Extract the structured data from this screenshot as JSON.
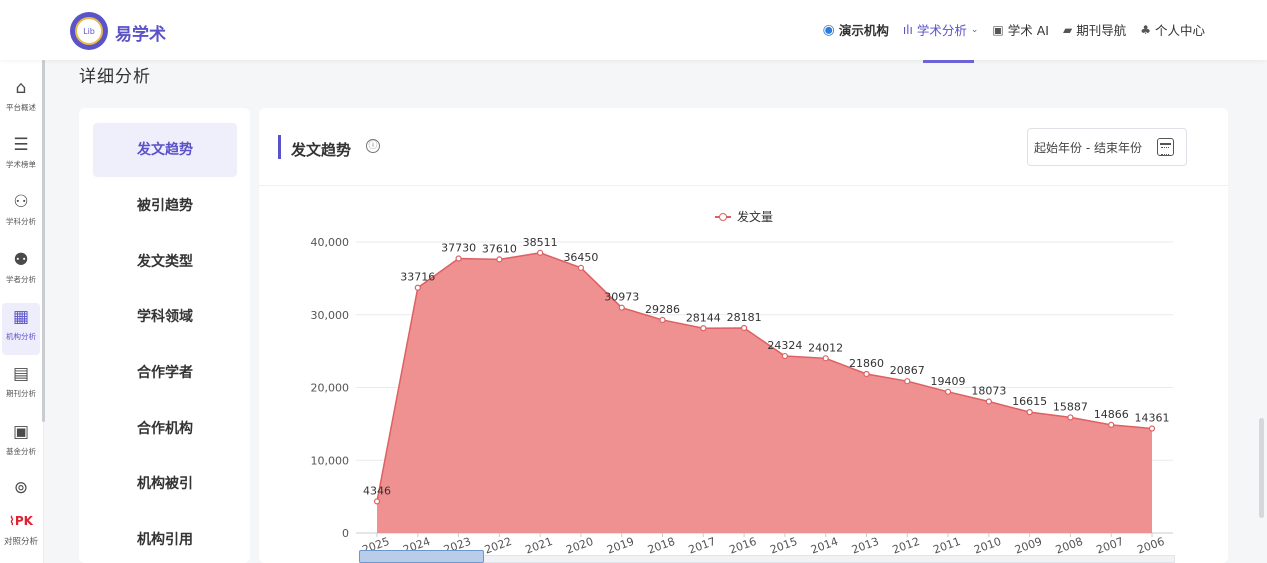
{
  "header": {
    "brand": "易学术",
    "logo_text": "Lib",
    "nav": [
      {
        "label": "演示机构",
        "icon": "institution-globe-icon"
      },
      {
        "label": "学术分析",
        "icon": "bar-chart-icon",
        "active": true,
        "dropdown": true
      },
      {
        "label": "学术 AI",
        "icon": "ai-bot-icon"
      },
      {
        "label": "期刊导航",
        "icon": "book-icon"
      },
      {
        "label": "个人中心",
        "icon": "user-icon"
      }
    ]
  },
  "sidebar": {
    "items": [
      {
        "label": "平台概述",
        "icon": "home-icon"
      },
      {
        "label": "学术榜单",
        "icon": "list-icon"
      },
      {
        "label": "学科分析",
        "icon": "hierarchy-icon"
      },
      {
        "label": "学者分析",
        "icon": "users-icon"
      },
      {
        "label": "机构分析",
        "icon": "building-icon",
        "active": true
      },
      {
        "label": "期刊分析",
        "icon": "journal-icon"
      },
      {
        "label": "基金分析",
        "icon": "money-icon"
      },
      {
        "label": "",
        "icon": "location-pin-icon"
      },
      {
        "label": "对照分析",
        "icon": "pk-chart-icon"
      }
    ]
  },
  "page_title": "详细分析",
  "submenu": {
    "items": [
      "发文趋势",
      "被引趋势",
      "发文类型",
      "学科领域",
      "合作学者",
      "合作机构",
      "机构被引",
      "机构引用"
    ],
    "active_index": 0
  },
  "card": {
    "title": "发文趋势",
    "info_icon": "ⓘ",
    "year_range_placeholder": "起始年份 - 结束年份"
  },
  "colors": {
    "accent": "#5a52c8",
    "series_line": "#dd6063",
    "series_fill": "#ee8b8b"
  },
  "chart_data": {
    "type": "area",
    "title": "",
    "xlabel": "",
    "ylabel": "",
    "x": [
      "2025",
      "2024",
      "2023",
      "2022",
      "2021",
      "2020",
      "2019",
      "2018",
      "2017",
      "2016",
      "2015",
      "2014",
      "2013",
      "2012",
      "2011",
      "2010",
      "2009",
      "2008",
      "2007",
      "2006"
    ],
    "series": [
      {
        "name": "发文量",
        "values": [
          4346,
          33716,
          37730,
          37610,
          38511,
          36450,
          30973,
          29286,
          28144,
          28181,
          24324,
          24012,
          21860,
          20867,
          19409,
          18073,
          16615,
          15887,
          14866,
          14361
        ]
      }
    ],
    "ylim": [
      0,
      40000
    ],
    "yticks": [
      "0",
      "10,000",
      "20,000",
      "30,000",
      "40,000"
    ],
    "grid": true,
    "legend": "top-center",
    "data_labels": true,
    "x_label_rotation": "rotated"
  }
}
